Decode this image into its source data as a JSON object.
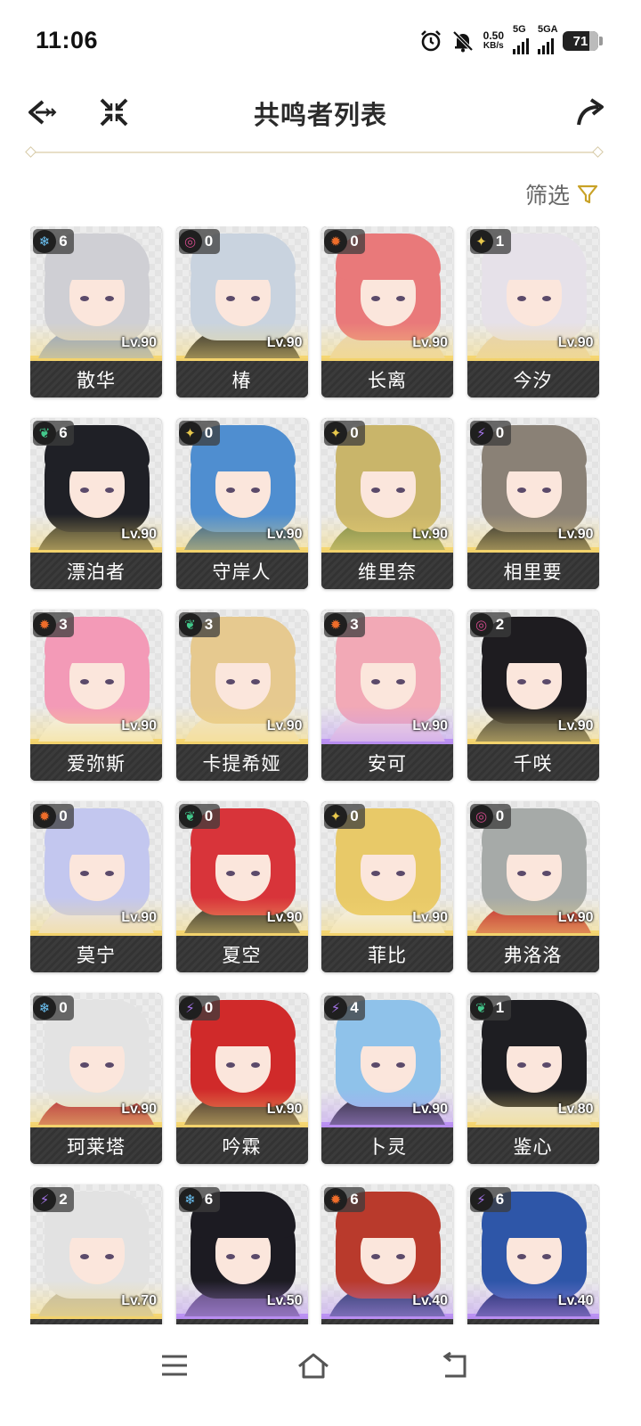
{
  "status_bar": {
    "time": "11:06",
    "net_speed_value": "0.50",
    "net_speed_unit": "KB/s",
    "signal1_label": "5G",
    "signal2_label": "5GA",
    "battery": "71"
  },
  "header": {
    "title": "共鸣者列表",
    "back_icon": "back-arrow-icon",
    "collapse_icon": "collapse-arrows-icon",
    "share_icon": "share-icon"
  },
  "filter": {
    "label": "筛选",
    "accent": "#c9a227"
  },
  "element_colors": {
    "glacio": "#6cc3f5",
    "havoc": "#d04a8a",
    "fusion": "#ef6d2a",
    "spectro": "#e8c84c",
    "aero": "#43c98c",
    "electro": "#a474e8"
  },
  "characters": [
    {
      "name": "散华",
      "level": "Lv.90",
      "chain": "6",
      "element": "glacio",
      "rarity": 5,
      "hair": "#cfcfd4",
      "outfit": "#8fa2c8"
    },
    {
      "name": "椿",
      "level": "Lv.90",
      "chain": "0",
      "element": "havoc",
      "rarity": 5,
      "hair": "#c9d3df",
      "outfit": "#2a2a2a"
    },
    {
      "name": "长离",
      "level": "Lv.90",
      "chain": "0",
      "element": "fusion",
      "rarity": 5,
      "hair": "#e9797a",
      "outfit": "#e7d4b8"
    },
    {
      "name": "今汐",
      "level": "Lv.90",
      "chain": "1",
      "element": "spectro",
      "rarity": 5,
      "hair": "#e6e1e9",
      "outfit": "#e4d2b6"
    },
    {
      "name": "漂泊者",
      "level": "Lv.90",
      "chain": "6",
      "element": "aero",
      "rarity": 5,
      "hair": "#1f2026",
      "outfit": "#3b3a30"
    },
    {
      "name": "守岸人",
      "level": "Lv.90",
      "chain": "0",
      "element": "spectro",
      "rarity": 5,
      "hair": "#4f8ed0",
      "outfit": "#2f5f8f"
    },
    {
      "name": "维里奈",
      "level": "Lv.90",
      "chain": "0",
      "element": "spectro",
      "rarity": 5,
      "hair": "#c9b56a",
      "outfit": "#7a8a4a"
    },
    {
      "name": "相里要",
      "level": "Lv.90",
      "chain": "0",
      "element": "electro",
      "rarity": 5,
      "hair": "#8a8176",
      "outfit": "#2d2d2d"
    },
    {
      "name": "爱弥斯",
      "level": "Lv.90",
      "chain": "3",
      "element": "fusion",
      "rarity": 5,
      "hair": "#f39ab7",
      "outfit": "#f2f2f2"
    },
    {
      "name": "卡提希娅",
      "level": "Lv.90",
      "chain": "3",
      "element": "aero",
      "rarity": 5,
      "hair": "#e6c98f",
      "outfit": "#f0e4cc"
    },
    {
      "name": "安可",
      "level": "Lv.90",
      "chain": "3",
      "element": "fusion",
      "rarity": 4,
      "hair": "#f2a9b6",
      "outfit": "#f5d9dc"
    },
    {
      "name": "千咲",
      "level": "Lv.90",
      "chain": "2",
      "element": "havoc",
      "rarity": 5,
      "hair": "#1e1c20",
      "outfit": "#3a3a3a"
    },
    {
      "name": "莫宁",
      "level": "Lv.90",
      "chain": "0",
      "element": "fusion",
      "rarity": 5,
      "hair": "#c3c7ef",
      "outfit": "#e8e4f4"
    },
    {
      "name": "夏空",
      "level": "Lv.90",
      "chain": "0",
      "element": "aero",
      "rarity": 5,
      "hair": "#d8343a",
      "outfit": "#2a2a2a"
    },
    {
      "name": "菲比",
      "level": "Lv.90",
      "chain": "0",
      "element": "spectro",
      "rarity": 5,
      "hair": "#e8c968",
      "outfit": "#f2f2f6"
    },
    {
      "name": "弗洛洛",
      "level": "Lv.90",
      "chain": "0",
      "element": "havoc",
      "rarity": 5,
      "hair": "#a6aaa8",
      "outfit": "#c0262e"
    },
    {
      "name": "珂莱塔",
      "level": "Lv.90",
      "chain": "0",
      "element": "glacio",
      "rarity": 5,
      "hair": "#e3e3e3",
      "outfit": "#b2283a"
    },
    {
      "name": "吟霖",
      "level": "Lv.90",
      "chain": "0",
      "element": "electro",
      "rarity": 5,
      "hair": "#d02a2a",
      "outfit": "#3a2a2a"
    },
    {
      "name": "卜灵",
      "level": "Lv.90",
      "chain": "4",
      "element": "electro",
      "rarity": 4,
      "hair": "#8fc2ea",
      "outfit": "#2a2a36"
    },
    {
      "name": "鉴心",
      "level": "Lv.80",
      "chain": "1",
      "element": "aero",
      "rarity": 5,
      "hair": "#1e1e22",
      "outfit": "#e8e6e2"
    },
    {
      "name": "",
      "level": "Lv.70",
      "chain": "2",
      "element": "electro",
      "rarity": 5,
      "hair": "#e2e2e2",
      "outfit": "#bfb9a8"
    },
    {
      "name": "",
      "level": "Lv.50",
      "chain": "6",
      "element": "glacio",
      "rarity": 4,
      "hair": "#1c1b22",
      "outfit": "#5d4a7a"
    },
    {
      "name": "",
      "level": "Lv.40",
      "chain": "6",
      "element": "fusion",
      "rarity": 4,
      "hair": "#b93a2c",
      "outfit": "#2b3a6a"
    },
    {
      "name": "",
      "level": "Lv.40",
      "chain": "6",
      "element": "electro",
      "rarity": 4,
      "hair": "#2e56a8",
      "outfit": "#1b2a6a"
    }
  ],
  "nav_bar": {
    "menu_icon": "menu-icon",
    "home_icon": "home-icon",
    "back_icon": "back-icon"
  }
}
